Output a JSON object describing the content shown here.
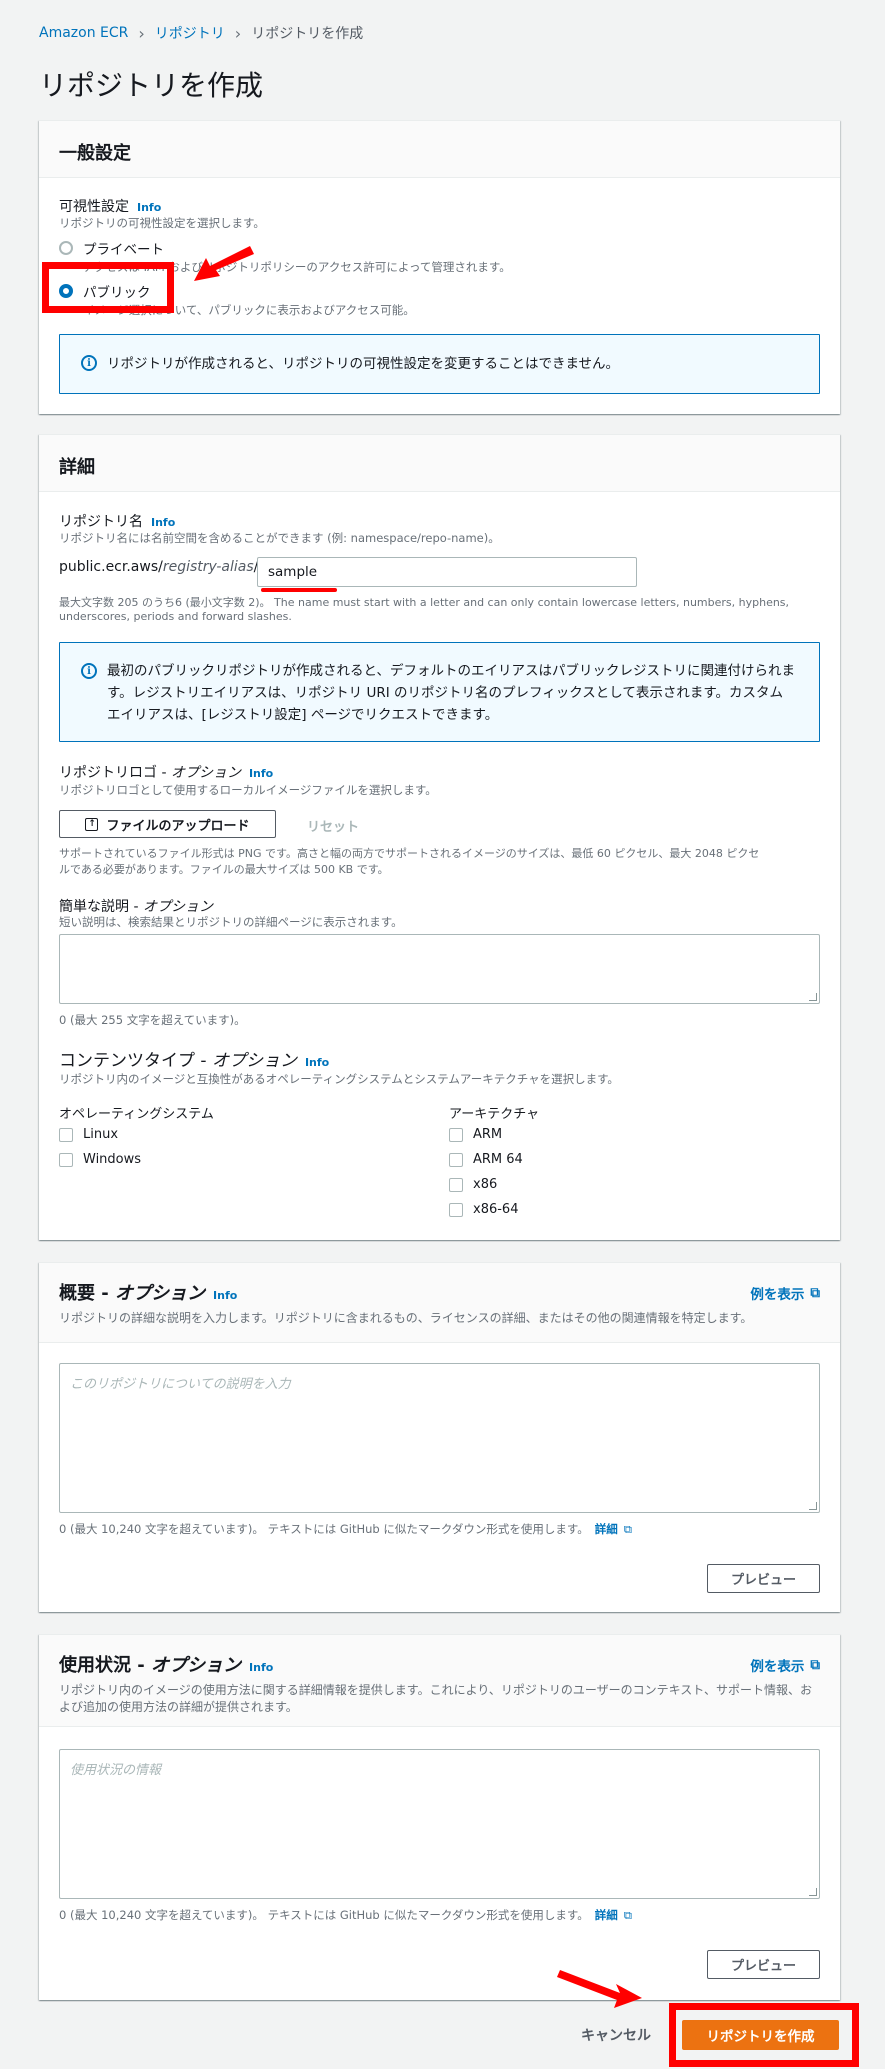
{
  "breadcrumb": {
    "root": "Amazon ECR",
    "section": "リポジトリ",
    "current": "リポジトリを作成"
  },
  "page_title": "リポジトリを作成",
  "general": {
    "title": "一般設定",
    "visibility_label": "可視性設定",
    "info": "Info",
    "visibility_desc": "リポジトリの可視性設定を選択します。",
    "private_label": "プライベート",
    "private_desc": "アクセスは IAM およびリポジトリポリシーのアクセス許可によって管理されます。",
    "public_label": "パブリック",
    "public_desc": "イメージ選択について、パブリックに表示およびアクセス可能。",
    "selected": "パブリック",
    "alert": "リポジトリが作成されると、リポジトリの可視性設定を変更することはできません。"
  },
  "details": {
    "title": "詳細",
    "repo_name_label": "リポジトリ名",
    "info": "Info",
    "repo_name_desc": "リポジトリ名には名前空間を含めることができます (例: namespace/repo-name)。",
    "prefix": "public.ecr.aws/",
    "alias": "registry-alias",
    "slash": "/",
    "repo_name_value": "sample",
    "repo_name_hint_1": "最大文字数 205 のうち6 (最小文字数 2)。 The name must start with a letter and can only contain lowercase letters, numbers, hyphens,",
    "repo_name_hint_2": "underscores, periods and forward slashes.",
    "alert": "最初のパブリックリポジトリが作成されると、デフォルトのエイリアスはパブリックレジストリに関連付けられます。レジストリエイリアスは、リポジトリ URI のリポジトリ名のプレフィックスとして表示されます。カスタムエイリアスは、[レジストリ設定] ページでリクエストできます。",
    "logo_label": "リポジトリロゴ - ",
    "logo_label_opt": "オプション",
    "logo_desc": "リポジトリロゴとして使用するローカルイメージファイルを選択します。",
    "upload_button": "ファイルのアップロード",
    "reset_button": "リセット",
    "logo_hint_1": "サポートされているファイル形式は PNG です。高さと幅の両方でサポートされるイメージのサイズは、最低 60 ピクセル、最大 2048 ピクセ",
    "logo_hint_2": "ルである必要があります。ファイルの最大サイズは 500 KB です。",
    "short_desc_label": "簡単な説明 - ",
    "short_desc_label_opt": "オプション",
    "short_desc_desc": "短い説明は、検索結果とリポジトリの詳細ページに表示されます。",
    "short_desc_count": "0 (最大 255 文字を超えています)。",
    "content_type_label": "コンテンツタイプ - ",
    "content_type_label_opt": "オプション",
    "content_type_desc": "リポジトリ内のイメージと互換性があるオペレーティングシステムとシステムアーキテクチャを選択します。",
    "os_label": "オペレーティングシステム",
    "os_options": [
      "Linux",
      "Windows"
    ],
    "arch_label": "アーキテクチャ",
    "arch_options": [
      "ARM",
      "ARM 64",
      "x86",
      "x86-64"
    ]
  },
  "about": {
    "title": "概要 - ",
    "title_opt": "オプション",
    "info": "Info",
    "desc": "リポジトリの詳細な説明を入力します。リポジトリに含まれるもの、ライセンスの詳細、またはその他の関連情報を特定します。",
    "example_link": "例を表示",
    "placeholder": "このリポジトリについての説明を入力",
    "count": "0 (最大 10,240 文字を超えています)。 テキストには GitHub に似たマークダウン形式を使用します。",
    "details_link": "詳細",
    "preview_button": "プレビュー"
  },
  "usage": {
    "title": "使用状況 - ",
    "title_opt": "オプション",
    "info": "Info",
    "desc_1": "リポジトリ内のイメージの使用方法に関する詳細情報を提供します。これにより、リポジトリのユーザーのコンテキスト、サポート情報、お",
    "desc_2": "よび追加の使用方法の詳細が提供されます。",
    "example_link": "例を表示",
    "placeholder": "使用状況の情報",
    "count": "0 (最大 10,240 文字を超えています)。 テキストには GitHub に似たマークダウン形式を使用します。",
    "details_link": "詳細",
    "preview_button": "プレビュー"
  },
  "footer": {
    "cancel": "キャンセル",
    "create": "リポジトリを作成"
  },
  "colors": {
    "annotation": "#ff0000",
    "primary": "#ec7211",
    "link": "#0073bb"
  }
}
